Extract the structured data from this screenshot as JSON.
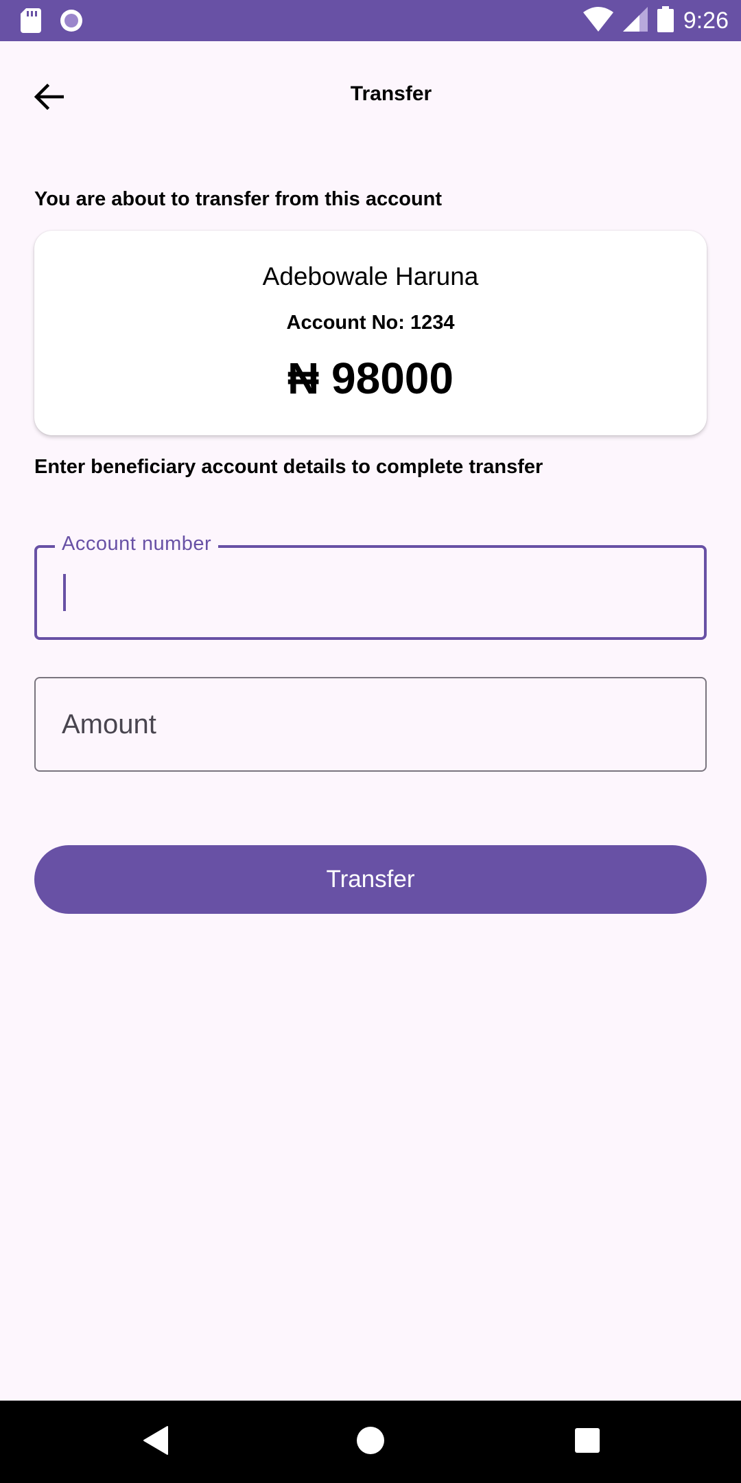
{
  "status_bar": {
    "time": "9:26",
    "icons": [
      "sd-card-icon",
      "record-icon",
      "wifi-icon",
      "signal-icon",
      "battery-icon"
    ]
  },
  "app_bar": {
    "title": "Transfer",
    "back_icon": "arrow-left-icon"
  },
  "source": {
    "label": "You are about to transfer from this account",
    "account_name": "Adebowale Haruna",
    "account_number": "Account No: 1234",
    "balance": "₦ 98000"
  },
  "beneficiary": {
    "label": "Enter beneficiary account details to complete transfer",
    "account_number_label": "Account number",
    "account_number_value": "",
    "amount_placeholder": "Amount",
    "amount_value": ""
  },
  "actions": {
    "transfer_label": "Transfer"
  },
  "colors": {
    "primary": "#6851a5",
    "background": "#fdf6fd",
    "outline": "#79747e",
    "nav_bar": "#000000"
  },
  "nav_bar": {
    "icons": [
      "back-triangle-icon",
      "home-circle-icon",
      "recents-square-icon"
    ]
  }
}
